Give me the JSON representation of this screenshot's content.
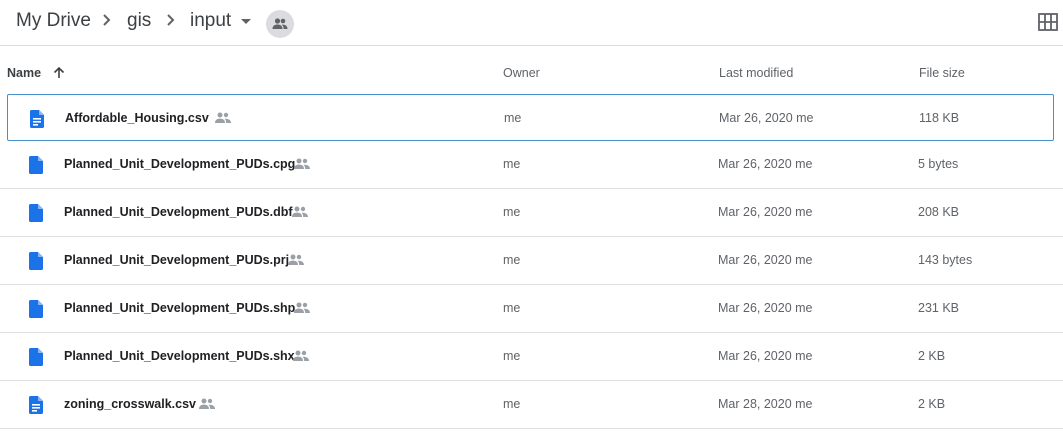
{
  "breadcrumb": {
    "items": [
      "My Drive",
      "gis",
      "input"
    ]
  },
  "columns": {
    "name": "Name",
    "owner": "Owner",
    "last_modified": "Last modified",
    "file_size": "File size"
  },
  "icons": {
    "file": "doc-file-icon",
    "shared": "shared-people-icon",
    "sort": "arrow-up-icon",
    "view_toggle": "grid-view-icon"
  },
  "colors": {
    "file_icon": "#1a73e8",
    "selection_border": "#4a90c8"
  },
  "files": [
    {
      "name": "Affordable_Housing.csv",
      "owner": "me",
      "modified": "Mar 26, 2020  me",
      "size": "118 KB",
      "type": "csv"
    },
    {
      "name": "Planned_Unit_Development_PUDs.cpg",
      "owner": "me",
      "modified": "Mar 26, 2020  me",
      "size": "5 bytes",
      "type": "file"
    },
    {
      "name": "Planned_Unit_Development_PUDs.dbf",
      "owner": "me",
      "modified": "Mar 26, 2020  me",
      "size": "208 KB",
      "type": "file"
    },
    {
      "name": "Planned_Unit_Development_PUDs.prj",
      "owner": "me",
      "modified": "Mar 26, 2020  me",
      "size": "143 bytes",
      "type": "file"
    },
    {
      "name": "Planned_Unit_Development_PUDs.shp",
      "owner": "me",
      "modified": "Mar 26, 2020  me",
      "size": "231 KB",
      "type": "file"
    },
    {
      "name": "Planned_Unit_Development_PUDs.shx",
      "owner": "me",
      "modified": "Mar 26, 2020  me",
      "size": "2 KB",
      "type": "file"
    },
    {
      "name": "zoning_crosswalk.csv",
      "owner": "me",
      "modified": "Mar 28, 2020  me",
      "size": "2 KB",
      "type": "csv"
    }
  ]
}
